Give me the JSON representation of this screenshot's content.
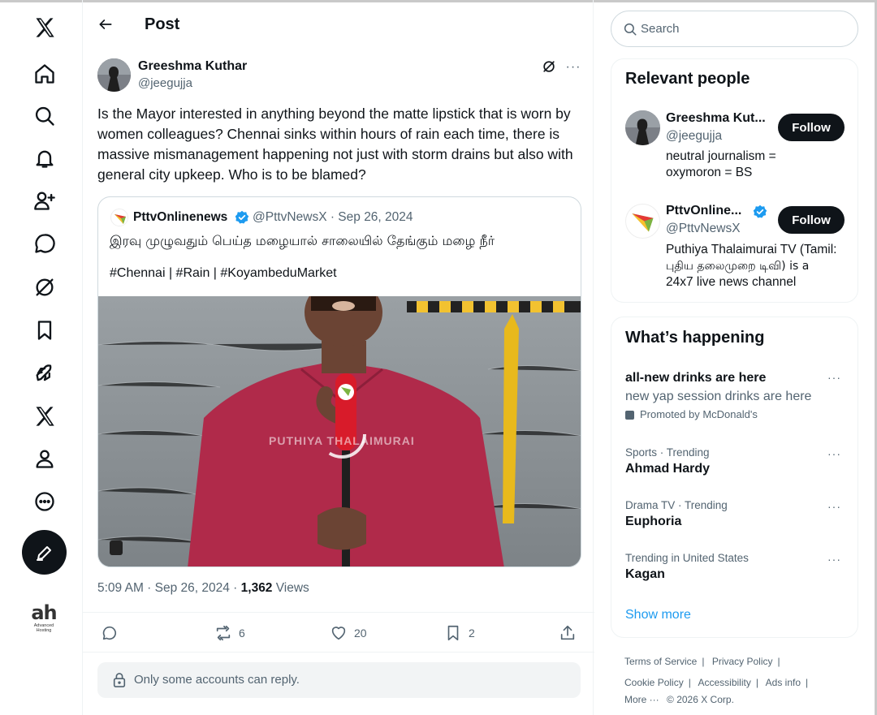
{
  "nav": {
    "items": [
      {
        "name": "x-logo"
      },
      {
        "name": "home"
      },
      {
        "name": "explore"
      },
      {
        "name": "notifications"
      },
      {
        "name": "follow"
      },
      {
        "name": "messages"
      },
      {
        "name": "grok"
      },
      {
        "name": "bookmarks"
      },
      {
        "name": "jobs"
      },
      {
        "name": "premium"
      },
      {
        "name": "profile"
      },
      {
        "name": "more"
      }
    ],
    "ad_logo": {
      "brand": "ah",
      "sub1": "Advanced",
      "sub2": "Hosting"
    }
  },
  "header": {
    "title": "Post"
  },
  "post": {
    "author_name": "Greeshma Kuthar",
    "author_handle": "@jeegujja",
    "text": "Is the Mayor interested in anything beyond the matte lipstick that is worn by women colleagues? Chennai sinks within hours of rain each time, there is massive mismanagement happening not just with storm drains but also with general city upkeep. Who is to be blamed?",
    "quote": {
      "name": "PttvOnlinenews",
      "handle_date": "@PttvNewsX · Sep 26, 2024",
      "text": "இரவு முழுவதும் பெய்த மழையால் சாலையில் தேங்கும் மழை நீர்",
      "tags": "#Chennai | #Rain | #KoyambeduMarket",
      "watermark": "PUTHIYA THALAIMURAI"
    },
    "time": "5:09 AM · Sep 26, 2024 · ",
    "views_count": "1,362",
    "views_label": " Views",
    "actions": {
      "reposts": "6",
      "likes": "20",
      "bookmarks": "2"
    },
    "reply_notice": "Only some accounts can reply."
  },
  "search": {
    "placeholder": "Search"
  },
  "relevant": {
    "title": "Relevant people",
    "people": [
      {
        "name": "Greeshma Kut...",
        "handle": "@jeegujja",
        "bio1": "neutral journalism =",
        "bio2": "oxymoron = BS",
        "follow": "Follow"
      },
      {
        "name": "PttvOnline...",
        "handle": "@PttvNewsX",
        "bio1": "Puthiya Thalaimurai TV (Tamil:",
        "bio2": "புதிய தலைமுறை டிவி) is a",
        "bio3": "24x7 live news channel",
        "follow": "Follow"
      }
    ]
  },
  "happening": {
    "title": "What’s happening",
    "promo": {
      "title": "all-new drinks are here",
      "desc": "new yap session drinks are here",
      "promoted": "Promoted by McDonald's"
    },
    "trends": [
      {
        "meta": "Sports · Trending",
        "name": "Ahmad Hardy"
      },
      {
        "meta": "Drama TV · Trending",
        "name": "Euphoria"
      },
      {
        "meta": "Trending in United States",
        "name": "Kagan"
      }
    ],
    "show_more": "Show more",
    "more_dots": "···"
  },
  "footer": {
    "terms": "Terms of Service",
    "privacy": "Privacy Policy",
    "cookie": "Cookie Policy",
    "accessibility": "Accessibility",
    "ads": "Ads info",
    "more": "More ···",
    "copyright": "© 2026 X Corp."
  },
  "colors": {
    "accent": "#1d9bf0",
    "text": "#0f1419",
    "muted": "#536471",
    "border": "#eff3f4"
  }
}
